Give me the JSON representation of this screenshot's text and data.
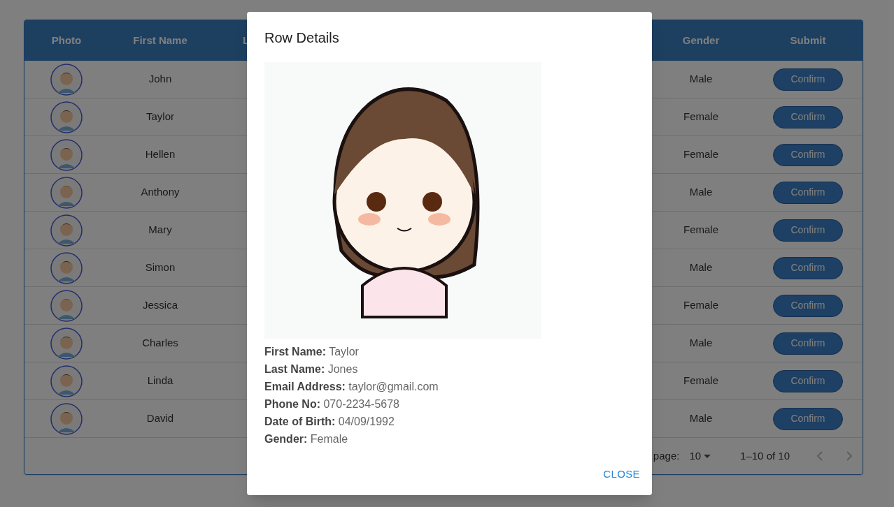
{
  "table": {
    "columns": [
      "Photo",
      "First Name",
      "L",
      "Gender",
      "Submit"
    ],
    "rows": [
      {
        "first_name": "John",
        "gender": "Male",
        "action": "Confirm"
      },
      {
        "first_name": "Taylor",
        "gender": "Female",
        "action": "Confirm"
      },
      {
        "first_name": "Hellen",
        "gender": "Female",
        "action": "Confirm"
      },
      {
        "first_name": "Anthony",
        "gender": "Male",
        "action": "Confirm"
      },
      {
        "first_name": "Mary",
        "gender": "Female",
        "action": "Confirm"
      },
      {
        "first_name": "Simon",
        "gender": "Male",
        "action": "Confirm"
      },
      {
        "first_name": "Jessica",
        "gender": "Female",
        "action": "Confirm"
      },
      {
        "first_name": "Charles",
        "gender": "Male",
        "action": "Confirm"
      },
      {
        "first_name": "Linda",
        "gender": "Female",
        "action": "Confirm"
      },
      {
        "first_name": "David",
        "gender": "Male",
        "action": "Confirm"
      }
    ],
    "pagination": {
      "rows_per_page_label": "page:",
      "rows_per_page": "10",
      "range": "1–10 of 10"
    }
  },
  "dialog": {
    "title": "Row Details",
    "fields": [
      {
        "label": "First Name:",
        "value": "Taylor"
      },
      {
        "label": "Last Name:",
        "value": "Jones"
      },
      {
        "label": "Email Address:",
        "value": "taylor@gmail.com"
      },
      {
        "label": "Phone No:",
        "value": "070-2234-5678"
      },
      {
        "label": "Date of Birth:",
        "value": "04/09/1992"
      },
      {
        "label": "Gender:",
        "value": "Female"
      }
    ],
    "close": "CLOSE"
  }
}
